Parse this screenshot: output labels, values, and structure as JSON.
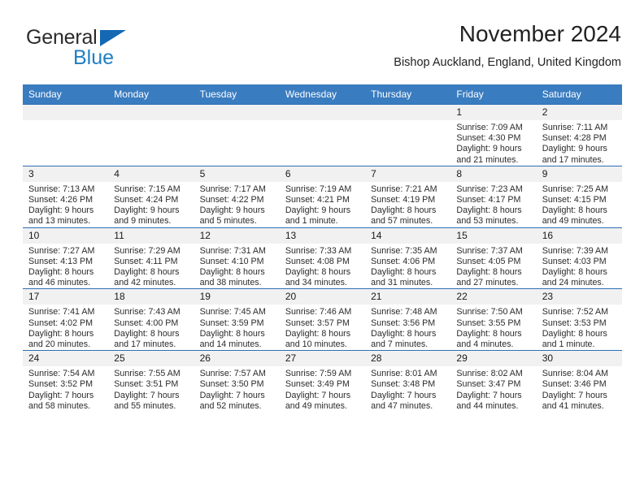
{
  "logo": {
    "part1": "General",
    "part2": "Blue",
    "triangle_color": "#1568b4",
    "blue_color": "#1f7ec4"
  },
  "header": {
    "title": "November 2024",
    "subtitle": "Bishop Auckland, England, United Kingdom",
    "header_bg": "#3a7cc0",
    "row_border": "#2f6fb5",
    "daynum_bg": "#f1f1f1"
  },
  "weekdays": [
    "Sunday",
    "Monday",
    "Tuesday",
    "Wednesday",
    "Thursday",
    "Friday",
    "Saturday"
  ],
  "weeks": [
    [
      {
        "day": "",
        "l1": "",
        "l2": "",
        "l3": "",
        "l4": ""
      },
      {
        "day": "",
        "l1": "",
        "l2": "",
        "l3": "",
        "l4": ""
      },
      {
        "day": "",
        "l1": "",
        "l2": "",
        "l3": "",
        "l4": ""
      },
      {
        "day": "",
        "l1": "",
        "l2": "",
        "l3": "",
        "l4": ""
      },
      {
        "day": "",
        "l1": "",
        "l2": "",
        "l3": "",
        "l4": ""
      },
      {
        "day": "1",
        "l1": "Sunrise: 7:09 AM",
        "l2": "Sunset: 4:30 PM",
        "l3": "Daylight: 9 hours",
        "l4": "and 21 minutes."
      },
      {
        "day": "2",
        "l1": "Sunrise: 7:11 AM",
        "l2": "Sunset: 4:28 PM",
        "l3": "Daylight: 9 hours",
        "l4": "and 17 minutes."
      }
    ],
    [
      {
        "day": "3",
        "l1": "Sunrise: 7:13 AM",
        "l2": "Sunset: 4:26 PM",
        "l3": "Daylight: 9 hours",
        "l4": "and 13 minutes."
      },
      {
        "day": "4",
        "l1": "Sunrise: 7:15 AM",
        "l2": "Sunset: 4:24 PM",
        "l3": "Daylight: 9 hours",
        "l4": "and 9 minutes."
      },
      {
        "day": "5",
        "l1": "Sunrise: 7:17 AM",
        "l2": "Sunset: 4:22 PM",
        "l3": "Daylight: 9 hours",
        "l4": "and 5 minutes."
      },
      {
        "day": "6",
        "l1": "Sunrise: 7:19 AM",
        "l2": "Sunset: 4:21 PM",
        "l3": "Daylight: 9 hours",
        "l4": "and 1 minute."
      },
      {
        "day": "7",
        "l1": "Sunrise: 7:21 AM",
        "l2": "Sunset: 4:19 PM",
        "l3": "Daylight: 8 hours",
        "l4": "and 57 minutes."
      },
      {
        "day": "8",
        "l1": "Sunrise: 7:23 AM",
        "l2": "Sunset: 4:17 PM",
        "l3": "Daylight: 8 hours",
        "l4": "and 53 minutes."
      },
      {
        "day": "9",
        "l1": "Sunrise: 7:25 AM",
        "l2": "Sunset: 4:15 PM",
        "l3": "Daylight: 8 hours",
        "l4": "and 49 minutes."
      }
    ],
    [
      {
        "day": "10",
        "l1": "Sunrise: 7:27 AM",
        "l2": "Sunset: 4:13 PM",
        "l3": "Daylight: 8 hours",
        "l4": "and 46 minutes."
      },
      {
        "day": "11",
        "l1": "Sunrise: 7:29 AM",
        "l2": "Sunset: 4:11 PM",
        "l3": "Daylight: 8 hours",
        "l4": "and 42 minutes."
      },
      {
        "day": "12",
        "l1": "Sunrise: 7:31 AM",
        "l2": "Sunset: 4:10 PM",
        "l3": "Daylight: 8 hours",
        "l4": "and 38 minutes."
      },
      {
        "day": "13",
        "l1": "Sunrise: 7:33 AM",
        "l2": "Sunset: 4:08 PM",
        "l3": "Daylight: 8 hours",
        "l4": "and 34 minutes."
      },
      {
        "day": "14",
        "l1": "Sunrise: 7:35 AM",
        "l2": "Sunset: 4:06 PM",
        "l3": "Daylight: 8 hours",
        "l4": "and 31 minutes."
      },
      {
        "day": "15",
        "l1": "Sunrise: 7:37 AM",
        "l2": "Sunset: 4:05 PM",
        "l3": "Daylight: 8 hours",
        "l4": "and 27 minutes."
      },
      {
        "day": "16",
        "l1": "Sunrise: 7:39 AM",
        "l2": "Sunset: 4:03 PM",
        "l3": "Daylight: 8 hours",
        "l4": "and 24 minutes."
      }
    ],
    [
      {
        "day": "17",
        "l1": "Sunrise: 7:41 AM",
        "l2": "Sunset: 4:02 PM",
        "l3": "Daylight: 8 hours",
        "l4": "and 20 minutes."
      },
      {
        "day": "18",
        "l1": "Sunrise: 7:43 AM",
        "l2": "Sunset: 4:00 PM",
        "l3": "Daylight: 8 hours",
        "l4": "and 17 minutes."
      },
      {
        "day": "19",
        "l1": "Sunrise: 7:45 AM",
        "l2": "Sunset: 3:59 PM",
        "l3": "Daylight: 8 hours",
        "l4": "and 14 minutes."
      },
      {
        "day": "20",
        "l1": "Sunrise: 7:46 AM",
        "l2": "Sunset: 3:57 PM",
        "l3": "Daylight: 8 hours",
        "l4": "and 10 minutes."
      },
      {
        "day": "21",
        "l1": "Sunrise: 7:48 AM",
        "l2": "Sunset: 3:56 PM",
        "l3": "Daylight: 8 hours",
        "l4": "and 7 minutes."
      },
      {
        "day": "22",
        "l1": "Sunrise: 7:50 AM",
        "l2": "Sunset: 3:55 PM",
        "l3": "Daylight: 8 hours",
        "l4": "and 4 minutes."
      },
      {
        "day": "23",
        "l1": "Sunrise: 7:52 AM",
        "l2": "Sunset: 3:53 PM",
        "l3": "Daylight: 8 hours",
        "l4": "and 1 minute."
      }
    ],
    [
      {
        "day": "24",
        "l1": "Sunrise: 7:54 AM",
        "l2": "Sunset: 3:52 PM",
        "l3": "Daylight: 7 hours",
        "l4": "and 58 minutes."
      },
      {
        "day": "25",
        "l1": "Sunrise: 7:55 AM",
        "l2": "Sunset: 3:51 PM",
        "l3": "Daylight: 7 hours",
        "l4": "and 55 minutes."
      },
      {
        "day": "26",
        "l1": "Sunrise: 7:57 AM",
        "l2": "Sunset: 3:50 PM",
        "l3": "Daylight: 7 hours",
        "l4": "and 52 minutes."
      },
      {
        "day": "27",
        "l1": "Sunrise: 7:59 AM",
        "l2": "Sunset: 3:49 PM",
        "l3": "Daylight: 7 hours",
        "l4": "and 49 minutes."
      },
      {
        "day": "28",
        "l1": "Sunrise: 8:01 AM",
        "l2": "Sunset: 3:48 PM",
        "l3": "Daylight: 7 hours",
        "l4": "and 47 minutes."
      },
      {
        "day": "29",
        "l1": "Sunrise: 8:02 AM",
        "l2": "Sunset: 3:47 PM",
        "l3": "Daylight: 7 hours",
        "l4": "and 44 minutes."
      },
      {
        "day": "30",
        "l1": "Sunrise: 8:04 AM",
        "l2": "Sunset: 3:46 PM",
        "l3": "Daylight: 7 hours",
        "l4": "and 41 minutes."
      }
    ]
  ]
}
